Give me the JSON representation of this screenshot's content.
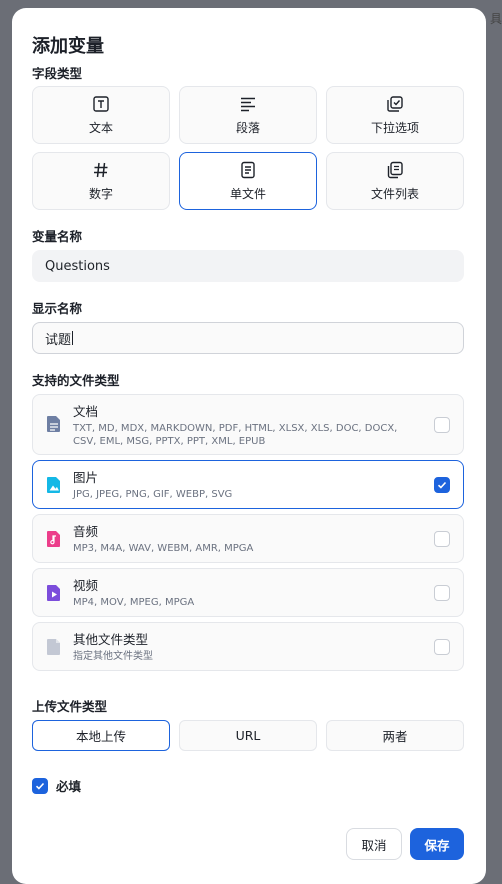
{
  "background_peek": "具",
  "dialog": {
    "title": "添加变量",
    "field_type_label": "字段类型",
    "field_types": [
      {
        "label": "文本",
        "icon": "text-icon"
      },
      {
        "label": "段落",
        "icon": "paragraph-icon"
      },
      {
        "label": "下拉选项",
        "icon": "dropdown-icon"
      },
      {
        "label": "数字",
        "icon": "hash-icon"
      },
      {
        "label": "单文件",
        "icon": "file-icon",
        "selected": true
      },
      {
        "label": "文件列表",
        "icon": "file-list-icon"
      }
    ],
    "variable_name_label": "变量名称",
    "variable_name_value": "Questions",
    "display_name_label": "显示名称",
    "display_name_value": "试题",
    "file_types_label": "支持的文件类型",
    "file_types": [
      {
        "name": "文档",
        "exts": "TXT, MD, MDX, MARKDOWN, PDF, HTML, XLSX, XLS, DOC, DOCX, CSV, EML, MSG, PPTX, PPT, XML, EPUB",
        "icon": "document-icon",
        "checked": false
      },
      {
        "name": "图片",
        "exts": "JPG, JPEG, PNG, GIF, WEBP, SVG",
        "icon": "image-icon",
        "checked": true
      },
      {
        "name": "音频",
        "exts": "MP3, M4A, WAV, WEBM, AMR, MPGA",
        "icon": "audio-icon",
        "checked": false
      },
      {
        "name": "视频",
        "exts": "MP4, MOV, MPEG, MPGA",
        "icon": "video-icon",
        "checked": false
      },
      {
        "name": "其他文件类型",
        "exts": "指定其他文件类型",
        "icon": "other-file-icon",
        "checked": false
      }
    ],
    "upload_type_label": "上传文件类型",
    "upload_types": [
      {
        "label": "本地上传",
        "selected": true
      },
      {
        "label": "URL"
      },
      {
        "label": "两者"
      }
    ],
    "required_label": "必填",
    "required_checked": true,
    "cancel_label": "取消",
    "save_label": "保存"
  },
  "colors": {
    "accent": "#1d63dd",
    "overlay": "#6b6e76",
    "document": "#6e7fa3",
    "image": "#14b8e6",
    "audio": "#ec3d8a",
    "video": "#7c4ddb",
    "other": "#c3c8d4"
  }
}
